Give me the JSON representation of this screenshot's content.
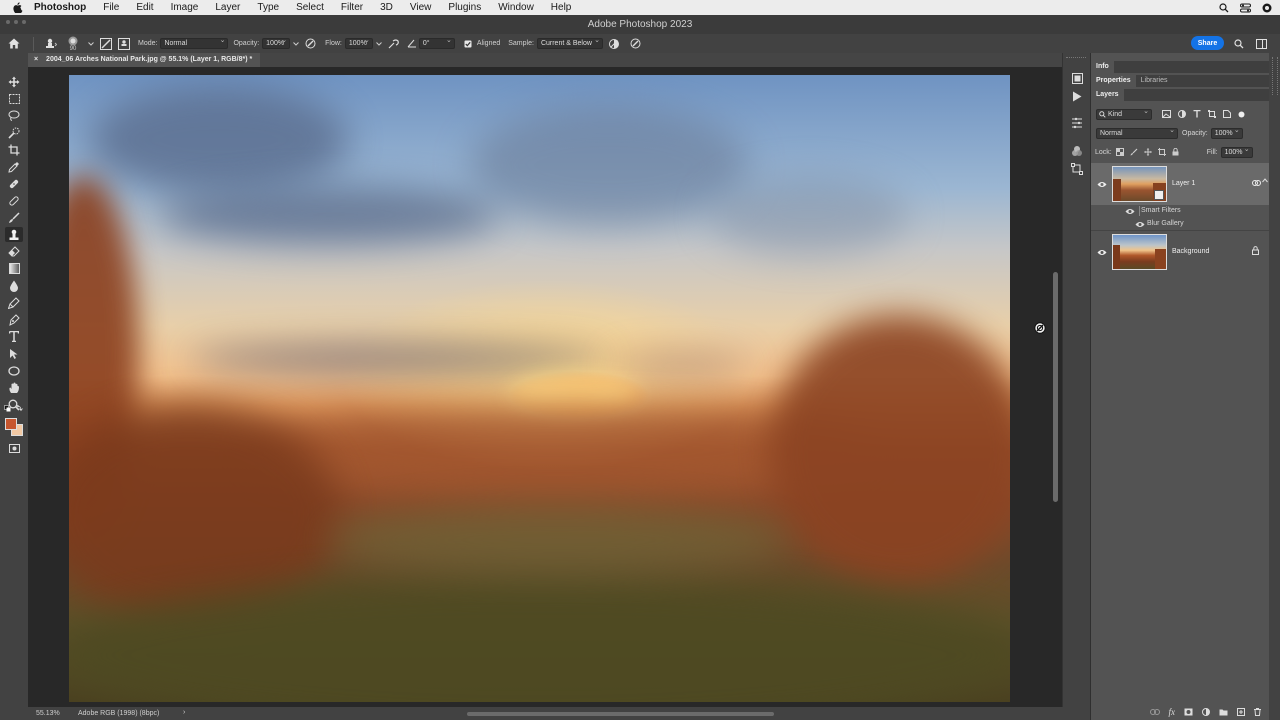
{
  "menubar": {
    "app_name": "Photoshop",
    "items": [
      "File",
      "Edit",
      "Image",
      "Layer",
      "Type",
      "Select",
      "Filter",
      "3D",
      "View",
      "Plugins",
      "Window",
      "Help"
    ]
  },
  "window": {
    "title": "Adobe Photoshop 2023"
  },
  "options_bar": {
    "brush_size": "90",
    "mode_label": "Mode:",
    "mode_value": "Normal",
    "opacity_label": "Opacity:",
    "opacity_value": "100%",
    "flow_label": "Flow:",
    "flow_value": "100%",
    "angle_value": "0°",
    "aligned_label": "Aligned",
    "sample_label": "Sample:",
    "sample_value": "Current & Below",
    "share_label": "Share"
  },
  "document": {
    "tab_title": "2004_06 Arches National Park.jpg @ 55.1% (Layer 1, RGB/8*) *",
    "close_glyph": "×"
  },
  "status_bar": {
    "zoom": "55.13%",
    "profile": "Adobe RGB (1998) (8bpc)",
    "arrow": "›"
  },
  "panels": {
    "info_tab": "Info",
    "properties_tab": "Properties",
    "libraries_tab": "Libraries",
    "layers_tab": "Layers",
    "filter_kind": "Kind",
    "blend_mode": "Normal",
    "opacity_label": "Opacity:",
    "opacity_value": "100%",
    "lock_label": "Lock:",
    "fill_label": "Fill:",
    "fill_value": "100%"
  },
  "layers": {
    "layer1_name": "Layer 1",
    "smart_filters_label": "Smart Filters",
    "blur_gallery_label": "Blur Gallery",
    "background_name": "Background"
  },
  "colors": {
    "accent": "#1473e6",
    "foreground_swatch": "#c7562e",
    "background_swatch": "#f2c9a4"
  }
}
